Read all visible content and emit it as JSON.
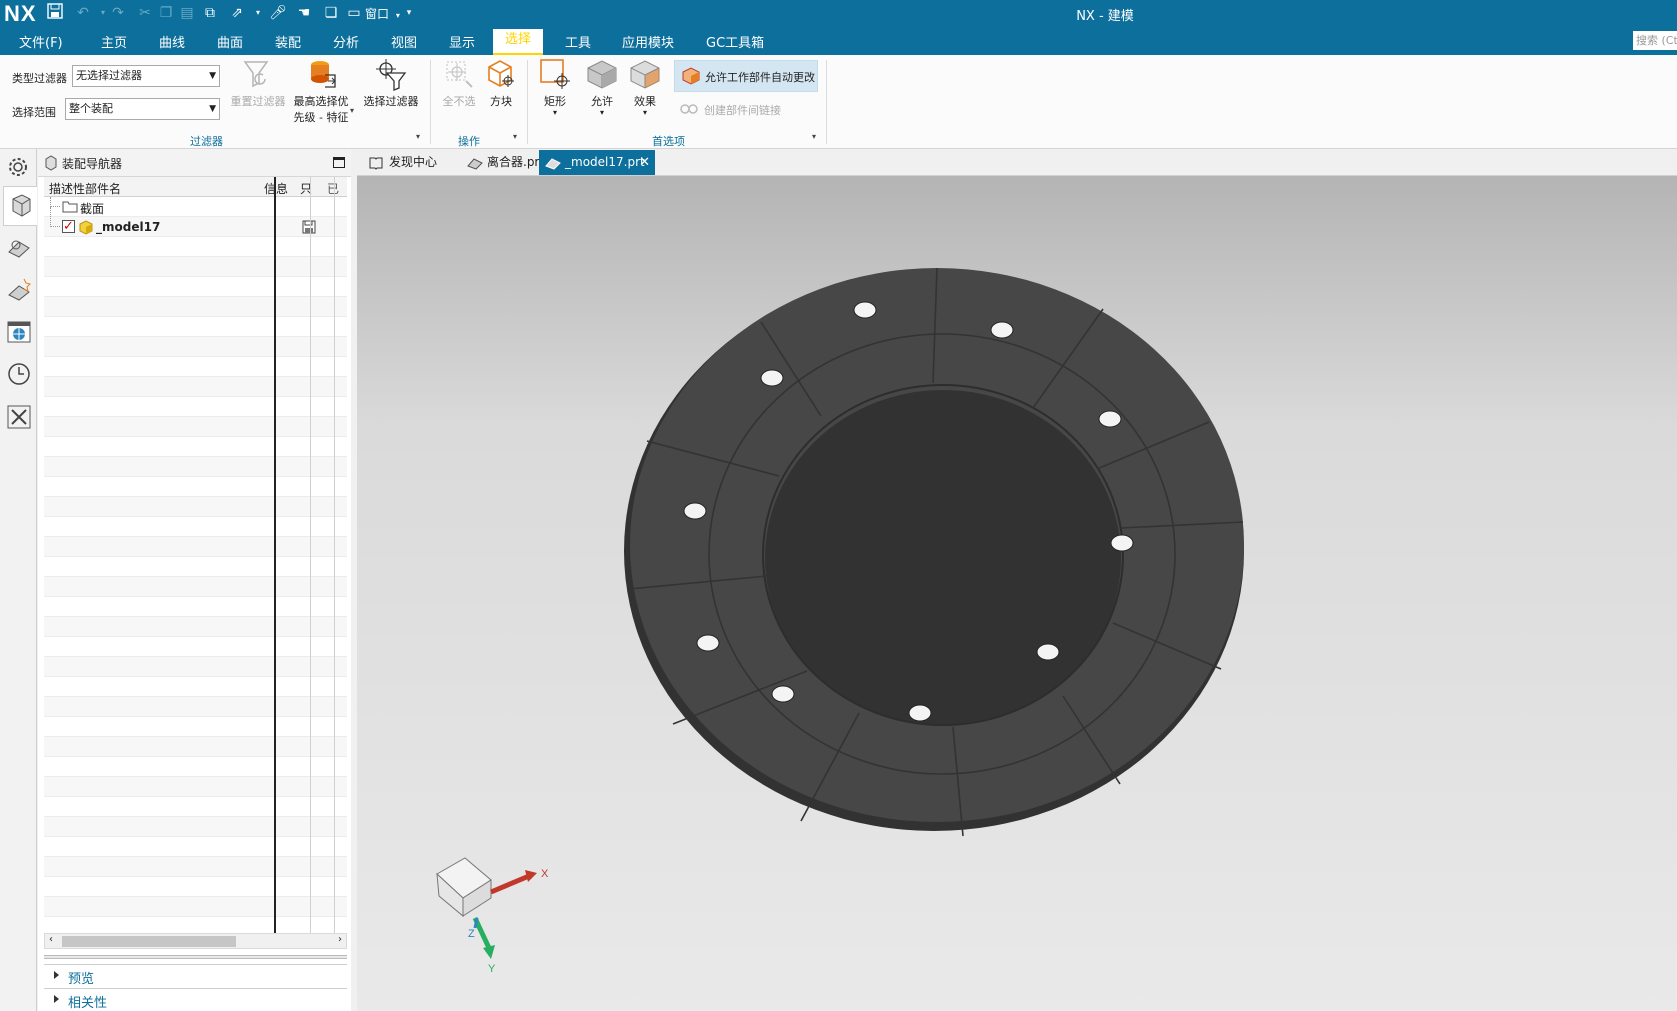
{
  "app": {
    "logo": "NX",
    "window_title": "NX - 建模",
    "quick_window_label": "窗口"
  },
  "menubar": {
    "items": [
      "文件(F)",
      "主页",
      "曲线",
      "曲面",
      "装配",
      "分析",
      "视图",
      "显示",
      "选择",
      "工具",
      "应用模块",
      "GC工具箱"
    ],
    "active": "选择",
    "search_placeholder": "搜索 (Ctrl+"
  },
  "ribbon": {
    "type_filter_label": "类型过滤器",
    "type_filter_value": "无选择过滤器",
    "scope_label": "选择范围",
    "scope_value": "整个装配",
    "reset_filter": "重置过滤器",
    "highest_priority_line1": "最高选择优",
    "highest_priority_line2": "先级 - 特征",
    "select_filter": "选择过滤器",
    "group_filter": "过滤器",
    "deselect_all": "全不选",
    "box": "方块",
    "group_ops": "操作",
    "rectangle": "矩形",
    "allow": "允许",
    "effect": "效果",
    "allow_auto_change": "允许工作部件自动更改",
    "create_interpart_link": "创建部件间链接",
    "group_prefs": "首选项"
  },
  "navigator": {
    "title": "装配导航器",
    "col_name": "描述性部件名",
    "col_info": "信息",
    "col_readonly": "只",
    "col_extra": "已",
    "items": [
      {
        "name": "截面"
      },
      {
        "name": "_model17"
      }
    ],
    "preview": "预览",
    "dependency": "相关性"
  },
  "doc_tabs": {
    "discovery": "发现中心",
    "clutch": "离合器.prt",
    "model": "_model17.prt"
  },
  "triad": {
    "x": "X",
    "y": "Y",
    "z": "Z"
  },
  "colors": {
    "brand": "#0d6f9c",
    "active_menu": "#ffd400",
    "part": "#454545"
  }
}
